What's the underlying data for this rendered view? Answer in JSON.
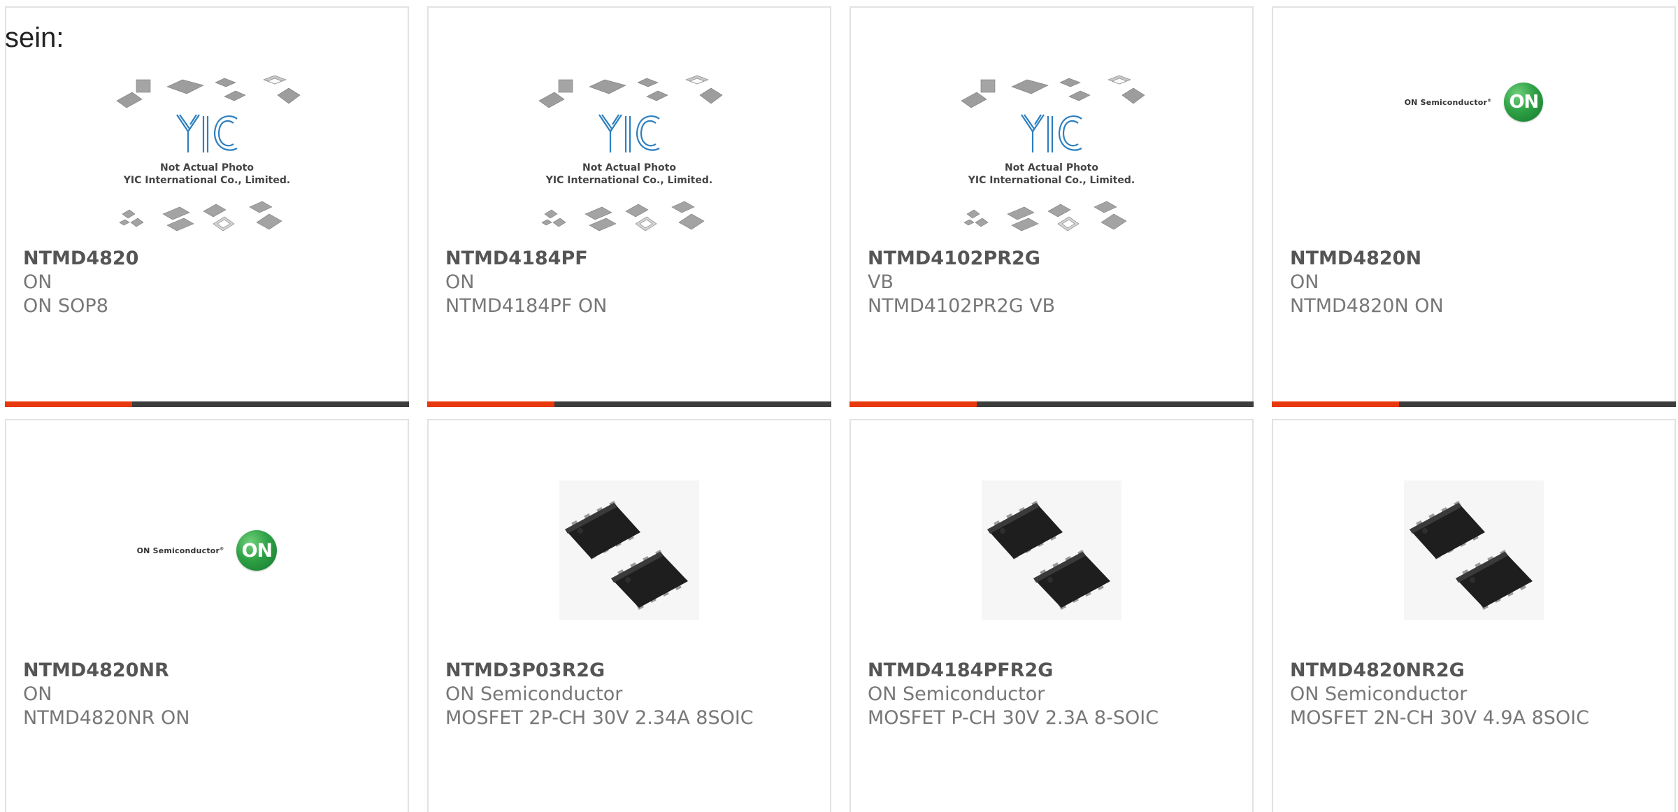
{
  "page": {
    "lead_text": "sein:"
  },
  "theme": {
    "accent_color": "#e8380d",
    "bar_color": "#3d3d3d",
    "border_color": "#e2e2e2",
    "pn_color": "#555555",
    "text_color": "#777777"
  },
  "placeholder": {
    "brand": "YIC",
    "line1": "Not Actual Photo",
    "line2": "YIC International Co., Limited."
  },
  "on_logo": {
    "wordmark": "ON Semiconductor",
    "emblem": "ON"
  },
  "products": [
    {
      "part_number": "NTMD4820",
      "manufacturer": "ON",
      "description": "ON SOP8",
      "image": "yic-placeholder-image"
    },
    {
      "part_number": "NTMD4184PF",
      "manufacturer": "ON",
      "description": "NTMD4184PF ON",
      "image": "yic-placeholder-image"
    },
    {
      "part_number": "NTMD4102PR2G",
      "manufacturer": "VB",
      "description": "NTMD4102PR2G VB",
      "image": "yic-placeholder-image"
    },
    {
      "part_number": "NTMD4820N",
      "manufacturer": "ON",
      "description": "NTMD4820N ON",
      "image": "on-semiconductor-logo"
    },
    {
      "part_number": "NTMD4820NR",
      "manufacturer": "ON",
      "description": "NTMD4820NR ON",
      "image": "on-semiconductor-logo"
    },
    {
      "part_number": "NTMD3P03R2G",
      "manufacturer": "ON Semiconductor",
      "description": "MOSFET 2P-CH 30V 2.34A 8SOIC",
      "image": "soic8-chip-photo"
    },
    {
      "part_number": "NTMD4184PFR2G",
      "manufacturer": "ON Semiconductor",
      "description": "MOSFET P-CH 30V 2.3A 8-SOIC",
      "image": "soic8-chip-photo"
    },
    {
      "part_number": "NTMD4820NR2G",
      "manufacturer": "ON Semiconductor",
      "description": "MOSFET 2N-CH 30V 4.9A 8SOIC",
      "image": "soic8-chip-photo"
    }
  ]
}
